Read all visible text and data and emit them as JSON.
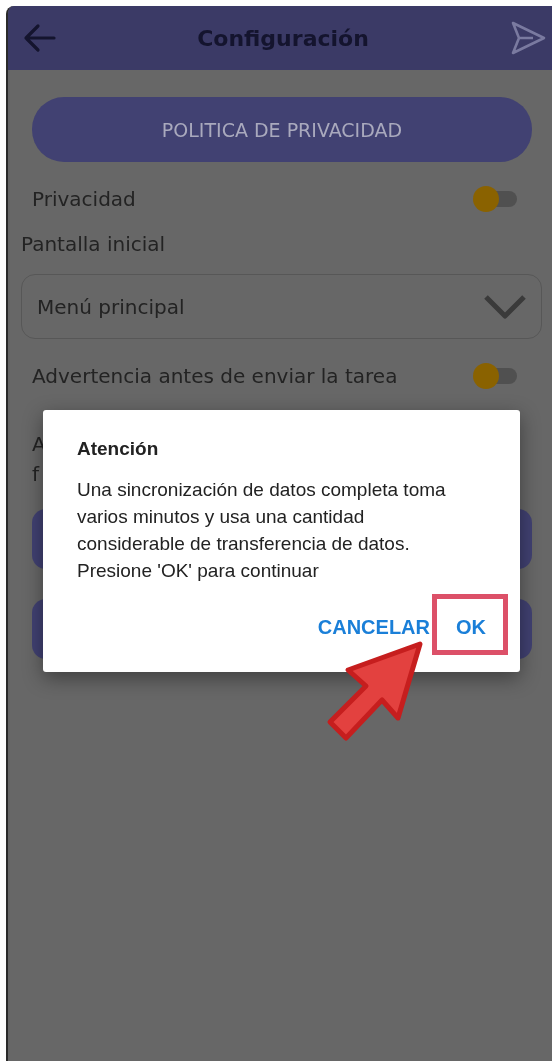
{
  "header": {
    "title": "Configuración"
  },
  "privacy_button": {
    "label": "POLITICA DE PRIVACIDAD"
  },
  "settings": [
    {
      "kind": "toggle",
      "label": "Privacidad",
      "on": false
    },
    {
      "kind": "heading",
      "label": "Pantalla inicial"
    },
    {
      "kind": "dropdown",
      "value": "Menú principal"
    },
    {
      "kind": "toggle",
      "label": "Advertencia antes de enviar la tarea",
      "on": false
    },
    {
      "kind": "partial",
      "lines": [
        "A",
        "f"
      ]
    }
  ],
  "dialog": {
    "title": "Atención",
    "message": "Una sincronización de datos completa toma varios minutos y usa una cantidad considerable de transferencia de datos. Presione 'OK' para continuar",
    "buttons": [
      {
        "label": "CANCELAR",
        "highlighted": false
      },
      {
        "label": "OK",
        "highlighted": true
      }
    ]
  }
}
